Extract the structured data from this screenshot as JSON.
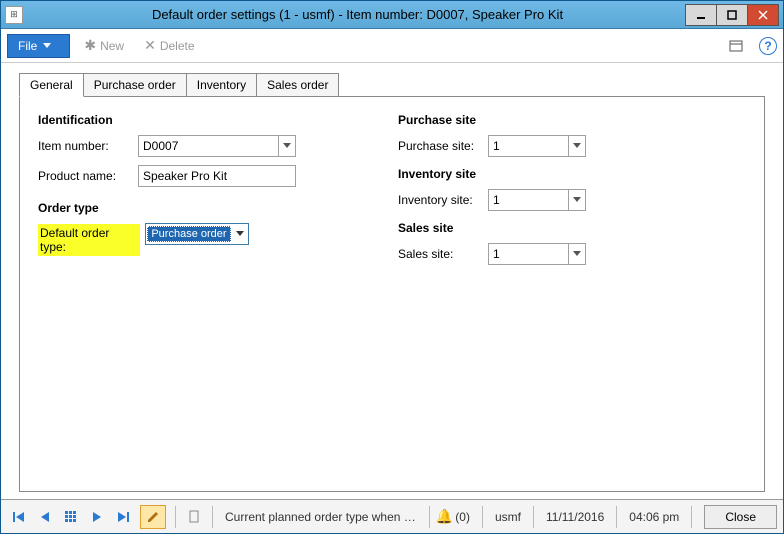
{
  "window": {
    "title": "Default order settings (1 - usmf) - Item number: D0007, Speaker Pro Kit"
  },
  "toolbar": {
    "file_label": "File",
    "new_label": "New",
    "delete_label": "Delete"
  },
  "tabs": {
    "general": "General",
    "purchase_order": "Purchase order",
    "inventory": "Inventory",
    "sales_order": "Sales order"
  },
  "form": {
    "identification": {
      "heading": "Identification",
      "item_number_label": "Item number:",
      "item_number_value": "D0007",
      "product_name_label": "Product name:",
      "product_name_value": "Speaker Pro Kit"
    },
    "order_type": {
      "heading": "Order type",
      "default_label": "Default order type:",
      "default_value": "Purchase order"
    },
    "purchase_site": {
      "heading": "Purchase site",
      "label": "Purchase site:",
      "value": "1"
    },
    "inventory_site": {
      "heading": "Inventory site",
      "label": "Inventory site:",
      "value": "1"
    },
    "sales_site": {
      "heading": "Sales site",
      "label": "Sales site:",
      "value": "1"
    }
  },
  "statusbar": {
    "message": "Current planned order type when cove...",
    "alert_count": "(0)",
    "company": "usmf",
    "date": "11/11/2016",
    "time": "04:06 pm",
    "close_label": "Close"
  }
}
